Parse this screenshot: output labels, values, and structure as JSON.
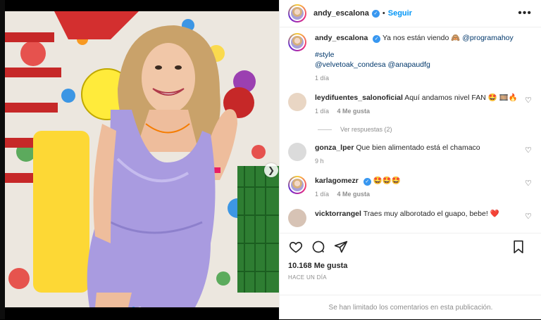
{
  "post": {
    "username": "andy_escalona",
    "follow_label": "Seguir",
    "separator": "•",
    "more_label": "•••"
  },
  "caption": {
    "username": "andy_escalona",
    "text": "Ya nos están viendo 🙈",
    "mention_main": "@programahoy",
    "hashtag": "#style",
    "mentions": [
      "@velvetoak_condesa",
      "@anapaudfg"
    ],
    "time": "1 día"
  },
  "comments": [
    {
      "username": "leydifuentes_salonoficial",
      "text": "Aquí andamos nivel FAN 🤩 🎞️🔥",
      "time": "1 día",
      "likes": "4 Me gusta",
      "verified": false
    },
    {
      "username": "gonza_lper",
      "text": "Que bien alimentado está el chamaco",
      "time": "9 h",
      "likes": "",
      "verified": false
    },
    {
      "username": "karlagomezr",
      "text": "🤩🤩🤩",
      "time": "1 día",
      "likes": "4 Me gusta",
      "verified": true
    },
    {
      "username": "vicktorrangel",
      "text": "Traes muy alborotado el guapo, bebe! ❤️",
      "time": "",
      "likes": "",
      "verified": false
    }
  ],
  "view_replies": "Ver respuestas (2)",
  "stats": {
    "likes": "10.168 Me gusta",
    "date": "HACE UN DÍA"
  },
  "comments_limited": "Se han limitado los comentarios en esta publicación.",
  "icons": [
    "heart-icon",
    "comment-icon",
    "share-icon",
    "bookmark-icon",
    "verified-icon",
    "more-icon",
    "chevron-right-icon"
  ],
  "colors": {
    "link": "#00376b",
    "follow": "#0095f6",
    "verified": "#3897f0",
    "dress": "#a99be0"
  }
}
